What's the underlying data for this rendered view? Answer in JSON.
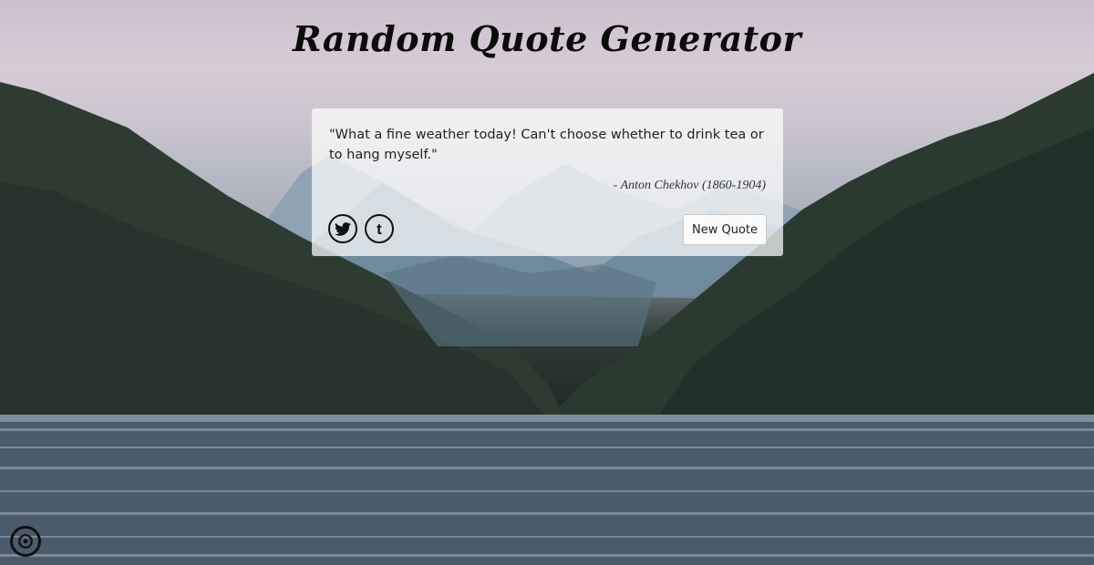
{
  "page": {
    "title": "Random Quote Generator"
  },
  "quote": {
    "text": "\"What a fine weather today! Can't choose whether to drink tea or to hang myself.\"",
    "author": "- Anton Chekhov (1860-1904)"
  },
  "actions": {
    "new_quote_label": "New Quote",
    "share_icons": [
      "twitter-icon",
      "tumblr-icon"
    ]
  },
  "footer": {
    "corner_icon": "github-icon"
  },
  "colors": {
    "card_background": "#ffffff",
    "text": "#222222",
    "title": "#0b0b0b"
  }
}
